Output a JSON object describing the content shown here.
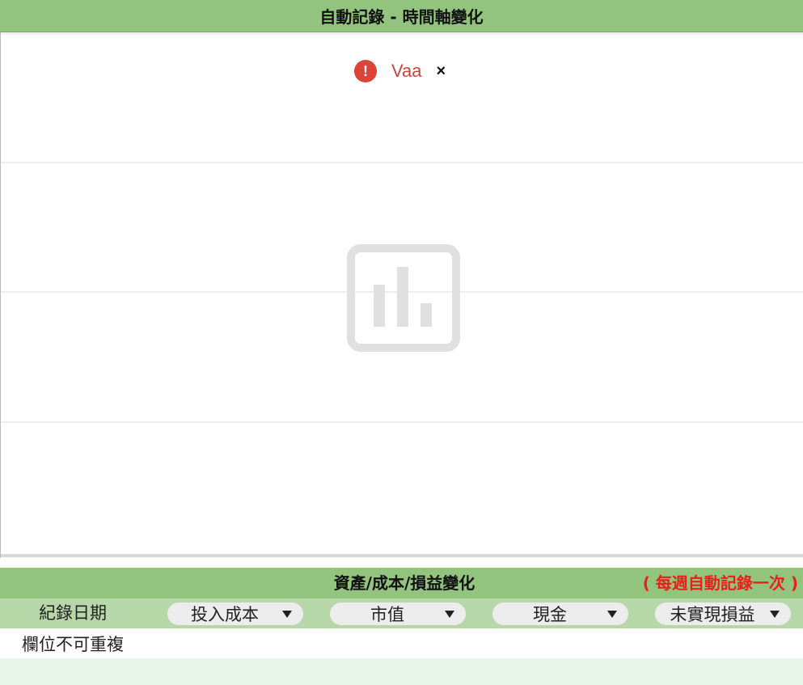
{
  "header": {
    "title": "自動記錄 - 時間軸變化"
  },
  "chart": {
    "error": {
      "message": "Vaa",
      "close_glyph": "×",
      "icon": "exclamation-icon",
      "color": "#db4437"
    },
    "placeholder_icon": "bar-chart-icon"
  },
  "section": {
    "title": "資產/成本/損益變化",
    "note": "( 每週自動記錄一次 )",
    "accent": "#93c47d",
    "note_color": "#e8201a"
  },
  "filters": {
    "date_label": "紀錄日期",
    "dropdowns": [
      {
        "label": "投入成本"
      },
      {
        "label": "市值"
      },
      {
        "label": "現金"
      },
      {
        "label": "未實現損益"
      }
    ]
  },
  "table": {
    "message": "欄位不可重複"
  }
}
